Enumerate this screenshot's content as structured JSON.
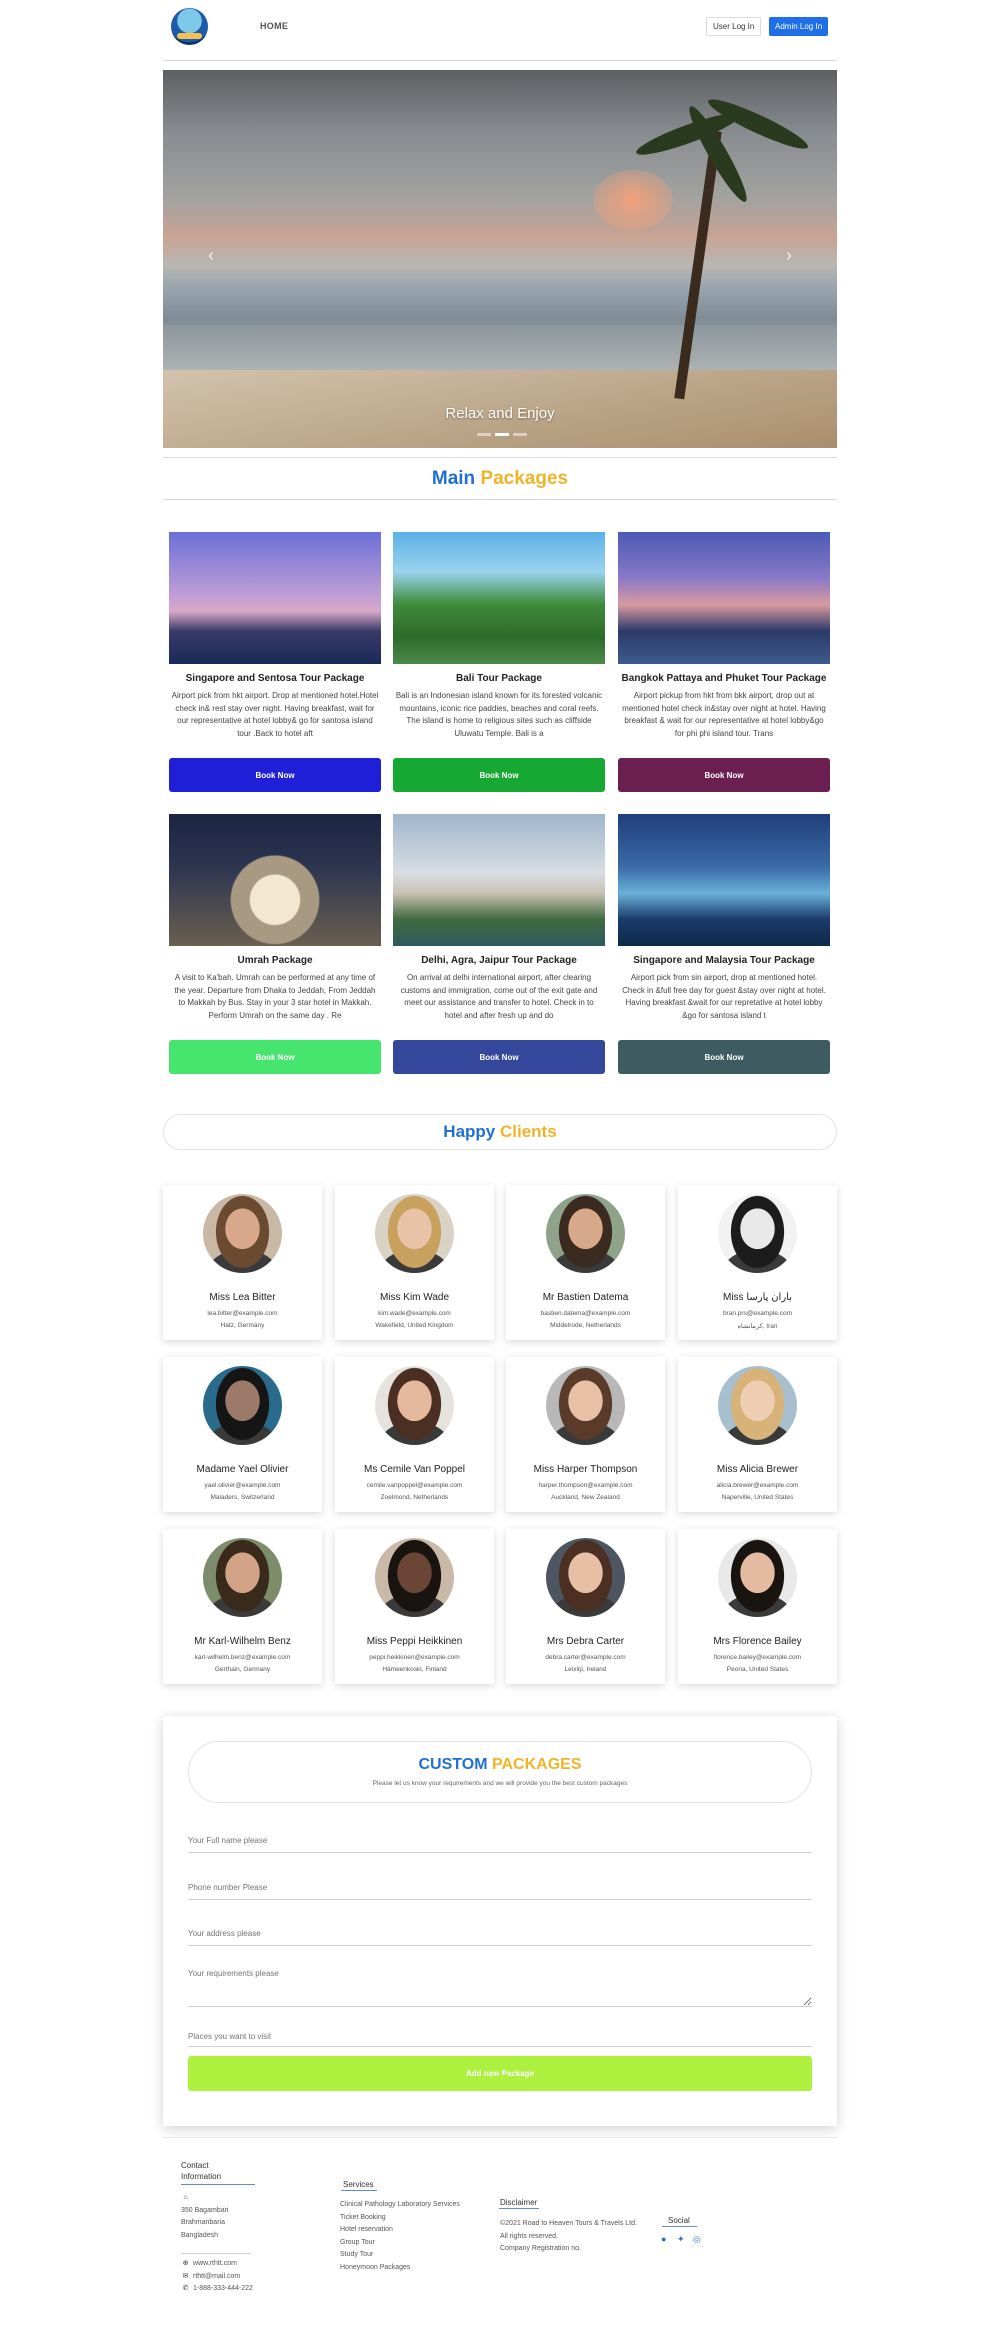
{
  "nav": {
    "home": "HOME",
    "user_login": "User Log In",
    "admin_login": "Admin Log In"
  },
  "hero": {
    "caption": "Relax and Enjoy",
    "slides": 3,
    "active_slide": 2
  },
  "packages_section": {
    "title_a": "Main",
    "title_b": "Packages"
  },
  "packages": [
    {
      "name": "Singapore and Sentosa Tour Package",
      "desc": "Airport pick from hkt airport. Drop at mentioned hotel.Hotel check in& rest stay over night. Having breakfast, wait for our representative at hotel lobby& go for santosa island tour .Back to hotel aft",
      "button": "Book Now",
      "color": "#1e1fd6"
    },
    {
      "name": "Bali Tour Package",
      "desc": "Bali is an Indonesian island known for its forested volcanic mountains, iconic rice paddies, beaches and coral reefs. The island is home to religious sites such as cliffside Uluwatu Temple. Bali is a",
      "button": "Book Now",
      "color": "#16a832"
    },
    {
      "name": "Bangkok Pattaya and Phuket Tour Package",
      "desc": "Airport pickup from hkt from bkk airport, drop out at mentioned hotel check in&stay over night at hotel. Having breakfast & wait for our representative at hotel lobby&go for phi phi island tour. Trans",
      "button": "Book Now",
      "color": "#6b1f50"
    },
    {
      "name": "Umrah Package",
      "desc": "A visit to Ka'bah. Umrah can be performed at any time of the year. Departure from Dhaka to Jeddah, From Jeddah to Makkah by Bus. Stay in your 3 star hotel in Makkah. Perform Umrah on the same day . Re",
      "button": "Book Now",
      "color": "#46e66e"
    },
    {
      "name": "Delhi, Agra, Jaipur Tour Package",
      "desc": "On arrival at delhi international airport, after clearing customs and immigration, come out of the exit gate and meet our assistance and transfer to hotel. Check in to hotel and after fresh up and do",
      "button": "Book Now",
      "color": "#34479a"
    },
    {
      "name": "Singapore and Malaysia Tour Package",
      "desc": "Airport pick from sin airport, drop at mentioned hotel. Check in &full free day for guest &stay over night at hotel. Having breakfast &wait for our repretative at hotel lobby &go for santosa island t",
      "button": "Book Now",
      "color": "#3d5b61"
    }
  ],
  "clients_section": {
    "title_a": "Happy",
    "title_b": "Clients"
  },
  "clients": [
    {
      "name": "Miss Lea Bitter",
      "email": "lea.bitter@example.com",
      "location": "Hatz, Germany",
      "skin": "#d9a88a",
      "hair": "#6b4a32",
      "bg": "#c9b8a6"
    },
    {
      "name": "Miss Kim Wade",
      "email": "kim.wade@example.com",
      "location": "Wakefield, United Kingdom",
      "skin": "#e9c3a8",
      "hair": "#c9a15e",
      "bg": "#d9d2c5"
    },
    {
      "name": "Mr Bastien Datema",
      "email": "bastien.datema@example.com",
      "location": "Middelrode, Netherlands",
      "skin": "#d7a88a",
      "hair": "#3a2a20",
      "bg": "#8fa38a"
    },
    {
      "name": "Miss باران پارسا",
      "email": "bran.prs@example.com",
      "location": "کرمانشاه, Iran",
      "skin": "#e8e8e8",
      "hair": "#1c1c1c",
      "bg": "#f2f2f2"
    },
    {
      "name": "Madame Yael Olivier",
      "email": "yael.olivier@example.com",
      "location": "Maladers, Switzerland",
      "skin": "#9c7a6a",
      "hair": "#151515",
      "bg": "#2a6a8a"
    },
    {
      "name": "Ms Cemile Van Poppel",
      "email": "cemile.vanpoppel@example.com",
      "location": "Zoelmond, Netherlands",
      "skin": "#e4b99e",
      "hair": "#4a2f22",
      "bg": "#e6e3df"
    },
    {
      "name": "Miss Harper Thompson",
      "email": "harper.thompson@example.com",
      "location": "Auckland, New Zealand",
      "skin": "#e7c0a6",
      "hair": "#5a3a28",
      "bg": "#b8b8b8"
    },
    {
      "name": "Miss Alicia Brewer",
      "email": "alicia.brewer@example.com",
      "location": "Naperville, United States",
      "skin": "#efcdb3",
      "hair": "#d7b379",
      "bg": "#a8bfcf"
    },
    {
      "name": "Mr Karl-Wilhelm Benz",
      "email": "karl-wilhelm.benz@example.com",
      "location": "Gerthain, Germany",
      "skin": "#d2a386",
      "hair": "#3a2a1c",
      "bg": "#7d8c6a"
    },
    {
      "name": "Miss Peppi Heikkinen",
      "email": "peppi.heikkinen@example.com",
      "location": "Hämeenkoski, Finland",
      "skin": "#6b4636",
      "hair": "#1a1410",
      "bg": "#c9b9a8"
    },
    {
      "name": "Mrs Debra Carter",
      "email": "debra.carter@example.com",
      "location": "Leixlip, Ireland",
      "skin": "#e6bfa4",
      "hair": "#4a2f22",
      "bg": "#4d5560"
    },
    {
      "name": "Mrs Florence Bailey",
      "email": "florence.bailey@example.com",
      "location": "Peoria, United States",
      "skin": "#e4bba0",
      "hair": "#1a1411",
      "bg": "#e9e9e9"
    }
  ],
  "custom": {
    "title_a": "CUSTOM",
    "title_b": "PACKAGES",
    "subtitle": "Please let us know your requirements and we will provide you the best custom packages",
    "fields": {
      "name": "Your Full name please",
      "phone": "Phone number Please",
      "address": "Your address please",
      "requirements": "Your requirements please",
      "places": "Places you want to visit"
    },
    "submit": "Add new Package"
  },
  "footer": {
    "contact_title_1": "Contact",
    "contact_title_2": "Information",
    "address": [
      "350 Bagambari",
      "Brahmanbaria",
      "Bangladesh"
    ],
    "website": "www.rthtt.com",
    "email": "rthtt@mail.com",
    "phone": "1-888-333-444-222",
    "services_title": "Services",
    "services": [
      "Clinical Pathology Laboratory Services",
      "Ticket Booking",
      "Hotel reservation",
      "Group Tour",
      "Study Tour",
      "Honeymoon Packages"
    ],
    "disclaimer_title": "Disclaimer",
    "disclaimer": [
      "©2021 Road to Heaven Tours & Travels Ltd.",
      "All rights reserved.",
      "Company Registration no."
    ],
    "social_title": "Social"
  }
}
